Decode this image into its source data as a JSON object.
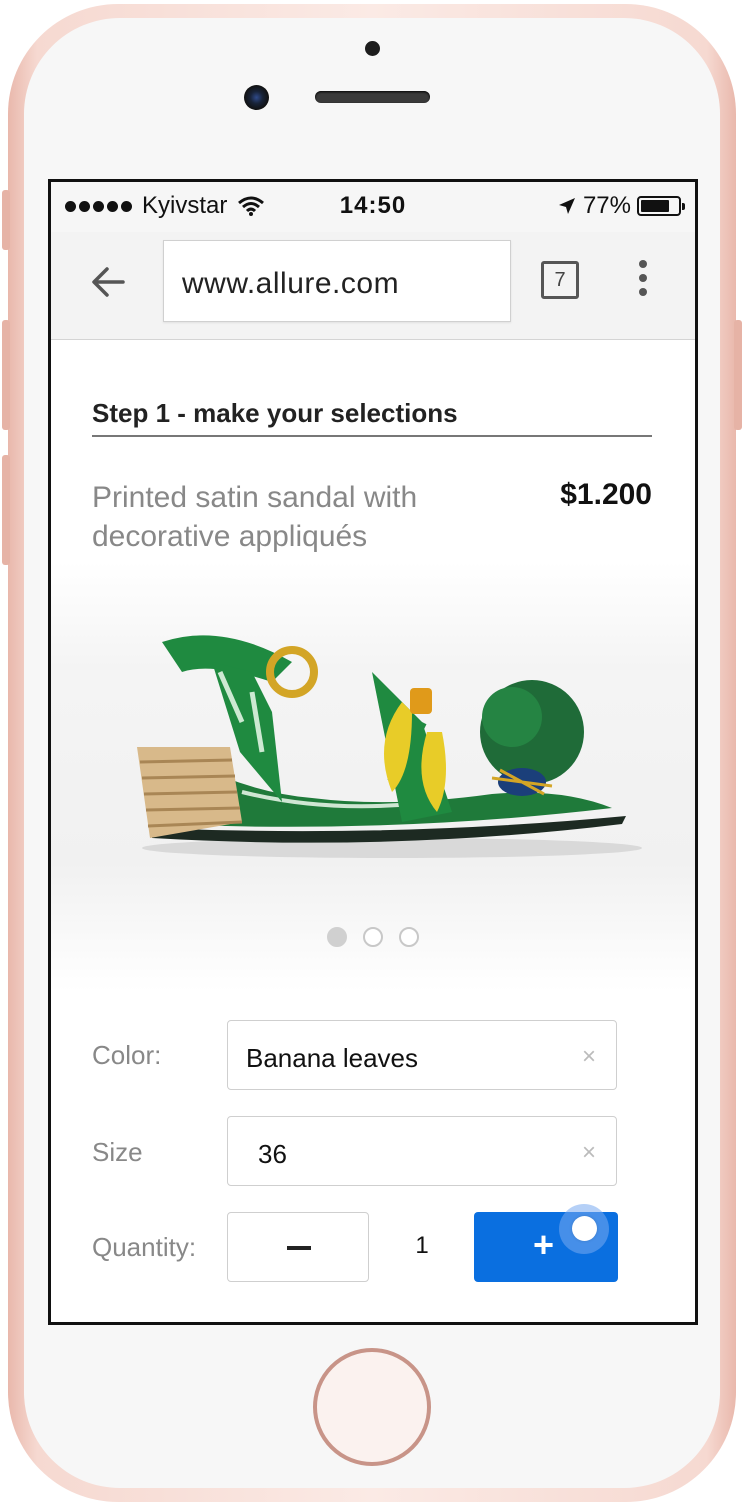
{
  "status_bar": {
    "carrier": "Kyivstar",
    "time": "14:50",
    "battery": "77%",
    "battery_level": 0.77
  },
  "browser": {
    "url": "www.allure.com",
    "tab_count": "7"
  },
  "page": {
    "step_title": "Step 1 - make your selections",
    "product_name": "Printed satin sandal with decorative appliqués",
    "price": "$1.200",
    "gallery": {
      "count": 3,
      "active_index": 0
    }
  },
  "form": {
    "color": {
      "label": "Color:",
      "value": "Banana leaves"
    },
    "size": {
      "label": "Size",
      "value": "36"
    },
    "quantity": {
      "label": "Quantity:",
      "value": "1"
    },
    "clear_glyph": "×",
    "plus_glyph": "+"
  },
  "colors": {
    "accent": "#0a6fe0",
    "phone": "#f6d9d1"
  }
}
